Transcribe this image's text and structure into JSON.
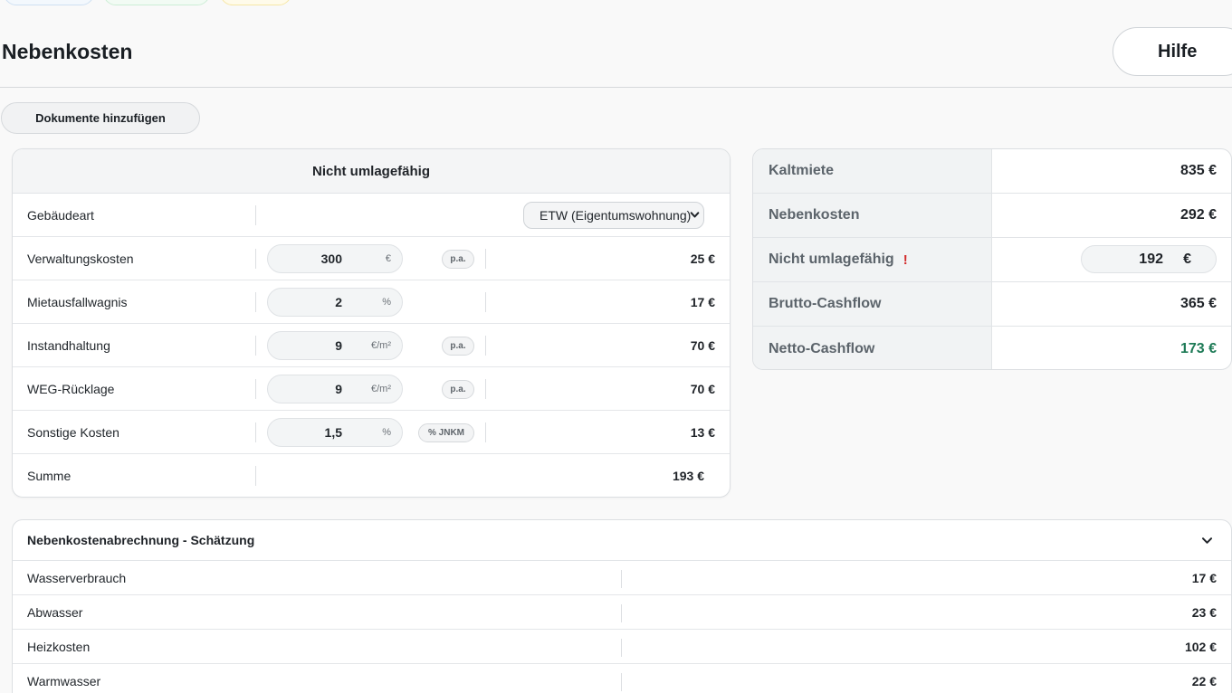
{
  "header": {
    "title": "Nebenkosten",
    "help_label": "Hilfe"
  },
  "actions": {
    "add_documents_label": "Dokumente hinzufügen"
  },
  "non_allocable": {
    "title": "Nicht umlagefähig",
    "building_type": {
      "label": "Gebäudeart",
      "selected": "ETW (Eigentumswohnung)"
    },
    "rows": [
      {
        "label": "Verwaltungskosten",
        "value": "300",
        "unit": "€",
        "tag": "p.a.",
        "amount": "25 €"
      },
      {
        "label": "Mietausfallwagnis",
        "value": "2",
        "unit": "%",
        "tag": "",
        "amount": "17 €"
      },
      {
        "label": "Instandhaltung",
        "value": "9",
        "unit": "€/m²",
        "tag": "p.a.",
        "amount": "70 €"
      },
      {
        "label": "WEG-Rücklage",
        "value": "9",
        "unit": "€/m²",
        "tag": "p.a.",
        "amount": "70 €"
      },
      {
        "label": "Sonstige Kosten",
        "value": "1,5",
        "unit": "%",
        "tag": "% JNKM",
        "amount": "13 €"
      }
    ],
    "sum": {
      "label": "Summe",
      "amount": "193 €"
    }
  },
  "summary": {
    "rows": [
      {
        "label": "Kaltmiete",
        "value": "835 €"
      },
      {
        "label": "Nebenkosten",
        "value": "292 €"
      },
      {
        "label": "Nicht umlagefähig",
        "warning": "!",
        "input_value": "192",
        "input_unit": "€"
      },
      {
        "label": "Brutto-Cashflow",
        "value": "365 €"
      },
      {
        "label": "Netto-Cashflow",
        "value": "173 €"
      }
    ],
    "positive_color": "#1d7a56",
    "warning_color": "#d22b2b"
  },
  "estimate": {
    "title": "Nebenkostenabrechnung - Schätzung",
    "rows": [
      {
        "label": "Wasserverbrauch",
        "amount": "17 €"
      },
      {
        "label": "Abwasser",
        "amount": "23 €"
      },
      {
        "label": "Heizkosten",
        "amount": "102 €"
      },
      {
        "label": "Warmwasser",
        "amount": "22 €"
      }
    ]
  }
}
